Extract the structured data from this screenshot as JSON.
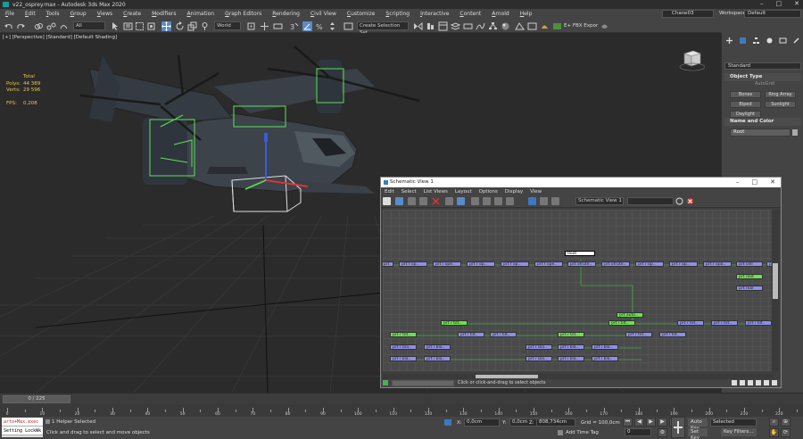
{
  "window": {
    "title": "v22_osprey.max - Autodesk 3ds Max 2020"
  },
  "menu": [
    "File",
    "Edit",
    "Tools",
    "Group",
    "Views",
    "Create",
    "Modifiers",
    "Animation",
    "Graph Editors",
    "Rendering",
    "Civil View",
    "Customize",
    "Scripting",
    "Interactive",
    "Content",
    "Arnold",
    "Help"
  ],
  "user": {
    "name": "Chane03",
    "workspaces_label": "Workspaces:",
    "workspace": "Default"
  },
  "toolbar": {
    "filter": "All",
    "refcoord": "World",
    "selection_set": "Create Selection Set",
    "fbx_label": "E+ FBX Expor"
  },
  "viewport": {
    "label": "[+] [Perspective] [Standard] [Default Shading]",
    "stats": {
      "total_label": "Total",
      "polys_label": "Polys:",
      "polys": "44 389",
      "verts_label": "Verts:",
      "verts": "29 596",
      "fps_label": "FPS:",
      "fps": "0,208"
    }
  },
  "command_panel": {
    "category": "Standard",
    "object_type": {
      "title": "Object Type",
      "autogrid": "AutoGrid",
      "buttons": [
        "Bones",
        "Ring Array",
        "Biped",
        "Sunlight",
        "Daylight"
      ]
    },
    "name_color": {
      "title": "Name and Color",
      "name": "Root"
    }
  },
  "schematic": {
    "title": "Schematic View 1",
    "menu": [
      "Edit",
      "Select",
      "List Views",
      "Layout",
      "Options",
      "Display",
      "View"
    ],
    "view_name": "Schematic View 1",
    "status": "Click or click-and-drag to select objects",
    "root": "Root",
    "row1": [
      "prt  ",
      "prt  f  op..",
      "prt  l  ope..",
      "prt  r  op..",
      "prt  f  op..",
      "prt  f  ope..",
      "prt  ofrute..",
      "prt  ofrute..",
      "prt  r  op..",
      "prt  r  op..",
      "prt  r  opa..",
      "prt  l  opa..",
      "prt  cell",
      "prt  "
    ],
    "row1b": [
      "prt  root",
      "prt  rear"
    ],
    "mid": "prt  auto..",
    "row2": [
      "prt  r  tilt..",
      "prt  l  tilt..",
      "prt  r  tilt..",
      "prt  r  tilt..",
      "prt  l  tilt.."
    ],
    "row3": [
      "prt  r  tilt..",
      "prt  l  tilt..",
      "prt  l  tilt..",
      "prt  r  tilt..",
      "prt  r  tilt..",
      "prt  l  tilt.."
    ],
    "row4": [
      "prt  r  bla..",
      "prt  l  bla..",
      "prt  r  bla..",
      "prt  l  bla..",
      "prt  l  bla.."
    ],
    "row5": [
      "prt  l  bla..",
      "prt  l  bla..",
      "prt  r  bla..",
      "prt  l  bla..",
      "prt  l  bla.."
    ]
  },
  "timeline": {
    "frame": "0 / 225",
    "ticks": [
      "0",
      "10",
      "20",
      "30",
      "40",
      "50",
      "60",
      "70",
      "80",
      "90",
      "100",
      "110",
      "120",
      "130",
      "140",
      "150",
      "160",
      "170",
      "180",
      "190",
      "200",
      "210",
      "220"
    ]
  },
  "status": {
    "maxscript_1": "arto+Max.exec",
    "maxscript_2": "Setting LockWk",
    "selected": "1 Helper Selected",
    "prompt": "Click and drag to select and move objects",
    "x_label": "X:",
    "x": "0,0cm",
    "y_label": "Y:",
    "y": "0,0cm",
    "z_label": "Z:",
    "z": "808,734cm",
    "grid": "Grid = 100,0cm",
    "add_time_tag": "Add Time Tag",
    "frame_field": "0",
    "auto_key": "Auto Key",
    "selected_dd": "Selected",
    "set_key": "Set Key",
    "key_filters": "Key Filters..."
  }
}
